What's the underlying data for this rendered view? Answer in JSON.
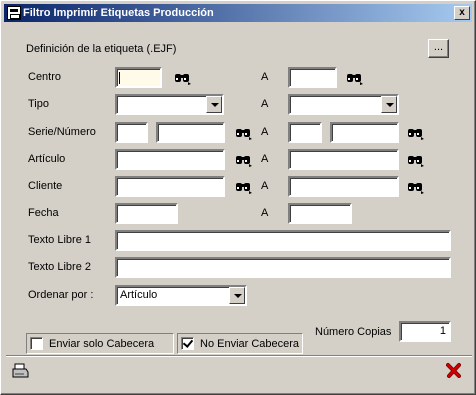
{
  "window": {
    "title": "Filtro Imprimir Etiquetas Producción",
    "close_label": "x"
  },
  "definicion": {
    "label": "Definición de la etiqueta (.EJF)",
    "browse_label": "..."
  },
  "fields": {
    "centro": {
      "label": "Centro",
      "to_label": "A",
      "from_value": "",
      "to_value": ""
    },
    "tipo": {
      "label": "Tipo",
      "to_label": "A",
      "from_value": "",
      "to_value": ""
    },
    "serie_numero": {
      "label": "Serie/Número",
      "to_label": "A",
      "from_serie": "",
      "from_numero": "",
      "to_serie": "",
      "to_numero": ""
    },
    "articulo": {
      "label": "Artículo",
      "to_label": "A",
      "from_value": "",
      "to_value": ""
    },
    "cliente": {
      "label": "Cliente",
      "to_label": "A",
      "from_value": "",
      "to_value": ""
    },
    "fecha": {
      "label": "Fecha",
      "to_label": "A",
      "from_value": "",
      "to_value": ""
    },
    "texto_libre_1": {
      "label": "Texto Libre 1",
      "value": ""
    },
    "texto_libre_2": {
      "label": "Texto Libre 2",
      "value": ""
    },
    "ordenar_por": {
      "label": "Ordenar por :",
      "value": "Artículo"
    }
  },
  "options": {
    "enviar_solo_cabecera": {
      "label": "Enviar solo Cabecera",
      "checked": false
    },
    "no_enviar_cabecera": {
      "label": "No Enviar Cabecera",
      "checked": true
    },
    "numero_copias": {
      "label": "Número Copias",
      "value": "1"
    }
  },
  "icons": {
    "search": "binoculars-icon",
    "print": "printer-icon",
    "cancel": "red-x-icon"
  },
  "colors": {
    "title_start": "#0a246a",
    "title_end": "#a6caf0",
    "face": "#d4d0c8",
    "cancel": "#cc0000"
  }
}
